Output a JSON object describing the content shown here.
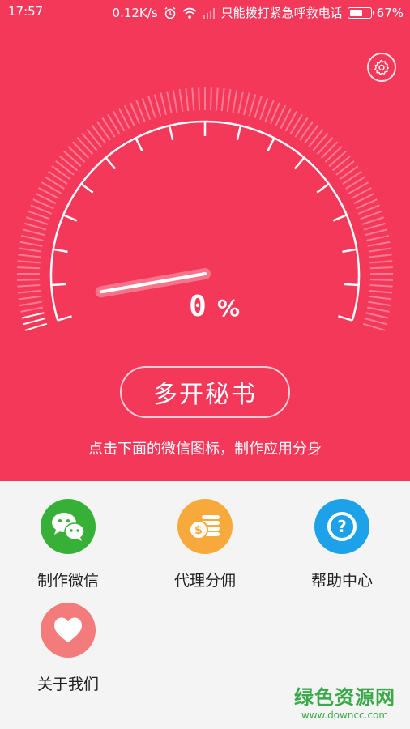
{
  "status_bar": {
    "time": "17:57",
    "speed": "0.12K/s",
    "carrier_notice": "只能拨打紧急呼救电话",
    "battery": "67%",
    "battery_level": 0.67
  },
  "gauge": {
    "value": 0,
    "value_text": "0",
    "unit": "%"
  },
  "main_button": {
    "label": "多开秘书"
  },
  "hint_text": "点击下面的微信图标，制作应用分身",
  "tiles": [
    {
      "label": "制作微信",
      "icon": "wechat-icon",
      "color": "#37b037"
    },
    {
      "label": "代理分佣",
      "icon": "coins-icon",
      "color": "#f7a93c"
    },
    {
      "label": "帮助中心",
      "icon": "help-icon",
      "color": "#1da1e8"
    },
    {
      "label": "关于我们",
      "icon": "heart-icon",
      "color": "#f47b7b"
    }
  ],
  "watermark": {
    "title": "绿色资源网",
    "url": "www.downcc.com"
  },
  "colors": {
    "hero": "#f4385a",
    "panel": "#f4f4f4"
  }
}
